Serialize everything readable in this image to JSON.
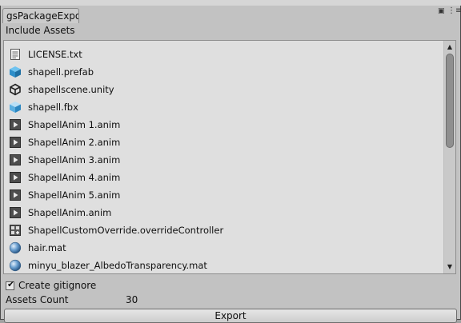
{
  "window": {
    "tab_title": "gsPackageExpo",
    "lock_icon": "lock-icon",
    "menu_icon": "menu-icon"
  },
  "include_assets_label": "Include Assets",
  "assets": [
    {
      "label": "LICENSE.txt",
      "icon": "text-file-icon"
    },
    {
      "label": "shapell.prefab",
      "icon": "prefab-icon"
    },
    {
      "label": "shapellscene.unity",
      "icon": "unity-scene-icon"
    },
    {
      "label": "shapell.fbx",
      "icon": "model-icon"
    },
    {
      "label": "ShapellAnim 1.anim",
      "icon": "animation-icon"
    },
    {
      "label": "ShapellAnim 2.anim",
      "icon": "animation-icon"
    },
    {
      "label": "ShapellAnim 3.anim",
      "icon": "animation-icon"
    },
    {
      "label": "ShapellAnim 4.anim",
      "icon": "animation-icon"
    },
    {
      "label": "ShapellAnim 5.anim",
      "icon": "animation-icon"
    },
    {
      "label": "ShapellAnim.anim",
      "icon": "animation-icon"
    },
    {
      "label": "ShapellCustomOverride.overrideController",
      "icon": "override-controller-icon"
    },
    {
      "label": "hair.mat",
      "icon": "material-icon"
    },
    {
      "label": "minyu_blazer_AlbedoTransparency.mat",
      "icon": "material-icon"
    }
  ],
  "create_gitignore": {
    "label": "Create gitignore",
    "checked": true
  },
  "assets_count": {
    "label": "Assets Count",
    "value": "30"
  },
  "export_button": "Export"
}
